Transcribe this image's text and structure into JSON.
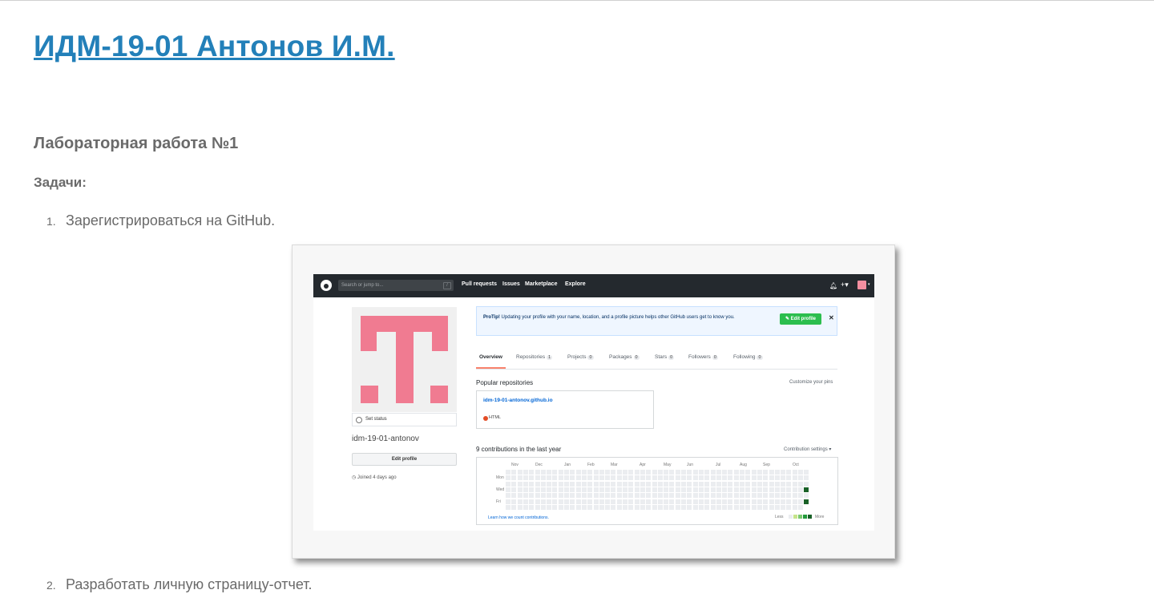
{
  "page": {
    "title": "ИДМ-19-01 Антонов И.М.",
    "lab_heading": "Лабораторная работа №1",
    "tasks_heading": "Задачи:",
    "items": [
      {
        "num": "1.",
        "text": "Зарегистрироваться на GitHub."
      },
      {
        "num": "2.",
        "text": "Разработать личную страницу-отчет."
      }
    ]
  },
  "github": {
    "search_placeholder": "Search or jump to...",
    "search_hotkey": "/",
    "nav": [
      "Pull requests",
      "Issues",
      "Marketplace",
      "Explore"
    ],
    "bell_icon": "bell-icon",
    "plus_label": "+▾",
    "avatar_caret": "▾",
    "set_status": "Set status",
    "username": "idm-19-01-antonov",
    "edit_profile": "Edit profile",
    "joined": "Joined 4 days ago",
    "joined_icon": "clock-icon",
    "protip_bold": "ProTip!",
    "protip_text": " Updating your profile with your name, location, and a profile picture helps other GitHub users get to know you.",
    "protip_button": "✎ Edit profile",
    "protip_close": "✕",
    "tabs": [
      {
        "label": "Overview",
        "count": ""
      },
      {
        "label": "Repositories",
        "count": "1"
      },
      {
        "label": "Projects",
        "count": "0"
      },
      {
        "label": "Packages",
        "count": "0"
      },
      {
        "label": "Stars",
        "count": "0"
      },
      {
        "label": "Followers",
        "count": "0"
      },
      {
        "label": "Following",
        "count": "0"
      }
    ],
    "popular_title": "Popular repositories",
    "customize_pins": "Customize your pins",
    "repo_name": "idm-19-01-antonov.github.io",
    "repo_lang": "HTML",
    "repo_lang_color": "#e34c26",
    "contrib_title": "9 contributions in the last year",
    "contrib_settings": "Contribution settings ▾",
    "months": [
      "Nov",
      "Dec",
      "Jan",
      "Feb",
      "Mar",
      "Apr",
      "May",
      "Jun",
      "Jul",
      "Aug",
      "Sep",
      "Oct"
    ],
    "weekdays": [
      "Mon",
      "Wed",
      "Fri"
    ],
    "learn_link": "Learn how we count contributions.",
    "legend_less": "Less",
    "legend_more": "More",
    "accent": "#2380b9"
  }
}
